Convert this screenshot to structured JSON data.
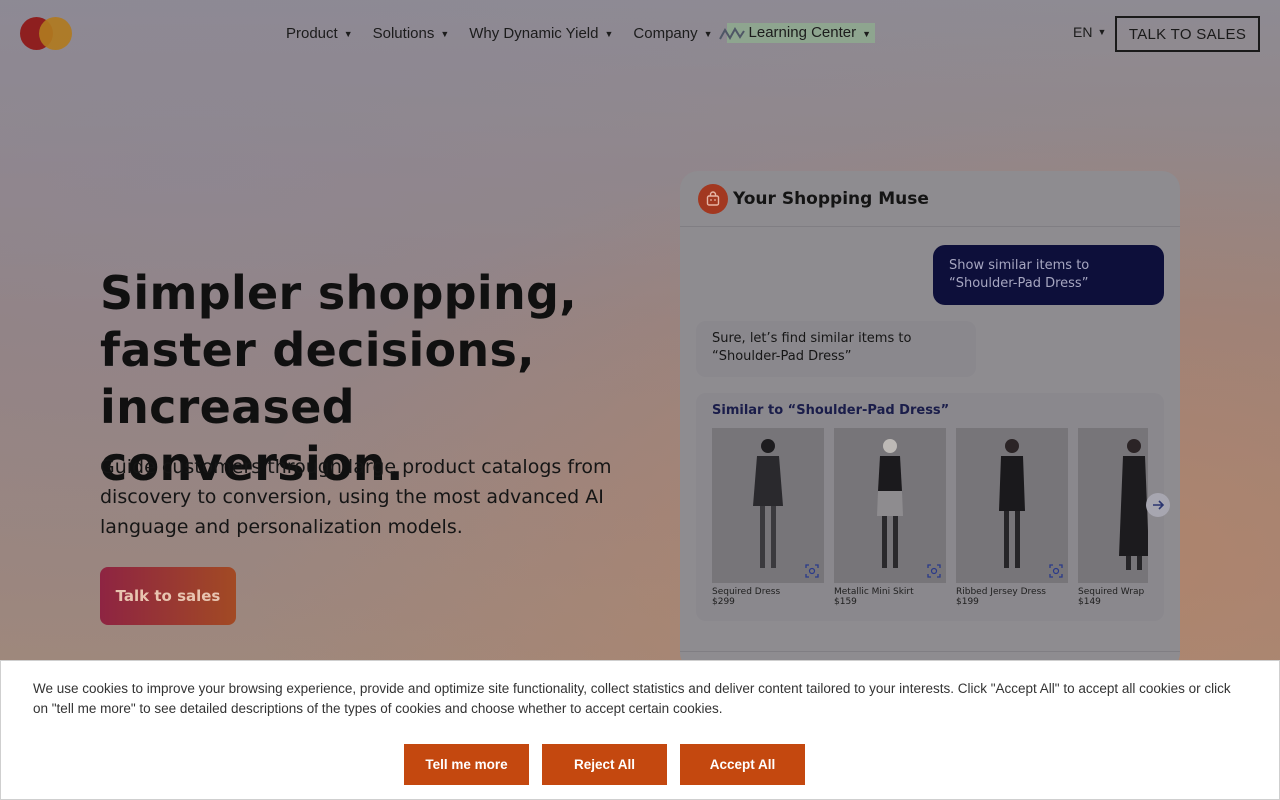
{
  "nav": {
    "items": [
      {
        "label": "Product"
      },
      {
        "label": "Solutions"
      },
      {
        "label": "Why Dynamic Yield"
      },
      {
        "label": "Company"
      },
      {
        "label": "Learning Center"
      }
    ],
    "language": "EN",
    "talk_label": "TALK TO SALES"
  },
  "hero": {
    "title_lines": [
      "Simpler shopping,",
      "faster decisions,",
      "increased conversion."
    ],
    "subtitle": "Guide customers through large product catalogs from discovery to conversion, using the most advanced AI language and personalization models.",
    "cta_label": "Talk to sales"
  },
  "chat": {
    "title": "Your Shopping Muse",
    "user_message": "Show similar items to “Shoulder-Pad Dress”",
    "bot_message": "Sure, let’s find similar items to “Shoulder-Pad Dress”",
    "similar_label": "Similar to “Shoulder-Pad Dress”",
    "products": [
      {
        "name": "Sequired Dress",
        "price": "$299"
      },
      {
        "name": "Metallic Mini Skirt",
        "price": "$159"
      },
      {
        "name": "Ribbed Jersey Dress",
        "price": "$199"
      },
      {
        "name": "Sequired Wrap Dress",
        "price": "$149"
      }
    ]
  },
  "cookie": {
    "text": "We use cookies to improve your browsing experience, provide and optimize site functionality, collect statistics and deliver content tailored to your interests. Click \"Accept All\" to accept all cookies or click on \"tell me more\" to see detailed descriptions of the types of cookies and choose whether to accept certain cookies.",
    "tell_more": "Tell me more",
    "reject": "Reject All",
    "accept": "Accept All"
  },
  "colors": {
    "accent_orange": "#c4480f",
    "chat_user_bubble": "#0d0f3a",
    "cta_gradient_start": "#8e2442",
    "cta_gradient_end": "#a24a24"
  }
}
